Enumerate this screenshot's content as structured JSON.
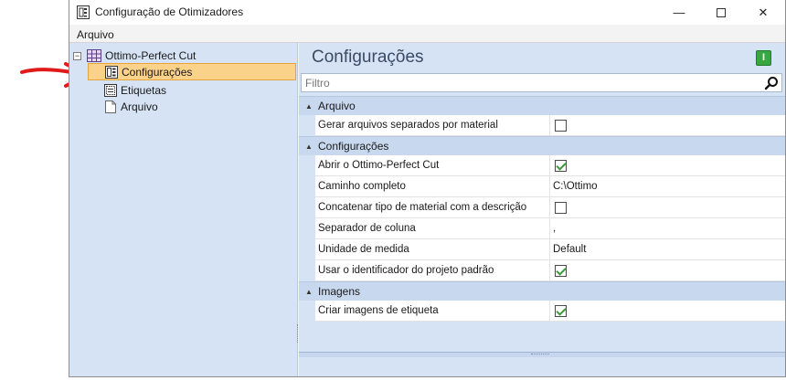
{
  "window": {
    "title": "Configuração de Otimizadores",
    "minimize_glyph": "—",
    "close_glyph": "✕"
  },
  "menu": {
    "items": [
      "Arquivo"
    ]
  },
  "tree": {
    "root": "Ottimo-Perfect Cut",
    "children": [
      "Configurações",
      "Etiquetas",
      "Arquivo"
    ],
    "selected": "Configurações"
  },
  "panel": {
    "title": "Configurações",
    "filter_placeholder": "Filtro"
  },
  "property_grid": {
    "categories": [
      {
        "label": "Arquivo",
        "properties": [
          {
            "name": "Gerar arquivos separados por material",
            "type": "checkbox",
            "checked": false
          }
        ]
      },
      {
        "label": "Configurações",
        "properties": [
          {
            "name": "Abrir o Ottimo-Perfect Cut",
            "type": "checkbox",
            "checked": true
          },
          {
            "name": "Caminho completo",
            "type": "text",
            "value": "C:\\Ottimo"
          },
          {
            "name": "Concatenar tipo de material com a descrição",
            "type": "checkbox",
            "checked": false
          },
          {
            "name": "Separador de coluna",
            "type": "text",
            "value": ","
          },
          {
            "name": "Unidade de medida",
            "type": "text",
            "value": "Default"
          },
          {
            "name": "Usar o identificador do projeto padrão",
            "type": "checkbox",
            "checked": true
          }
        ]
      },
      {
        "label": "Imagens",
        "properties": [
          {
            "name": "Criar imagens de etiqueta",
            "type": "checkbox",
            "checked": true
          }
        ]
      }
    ]
  },
  "colors": {
    "tree_bg": "#d6e3f4",
    "selection": "#fbd28a",
    "arrow": "#e01919",
    "green_badge": "#3aa640"
  }
}
